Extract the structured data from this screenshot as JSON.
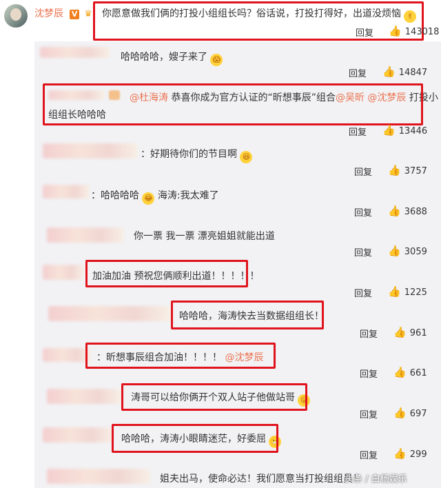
{
  "main_comment": {
    "username": "沈梦辰",
    "verified_badge": "V",
    "text": "你愿意做我们俩的打投小组组长吗？俗话说，打投打得好，出道没烦恼",
    "reply_label": "回复",
    "likes": "143018"
  },
  "replies": [
    {
      "text": "哈哈哈哈，嫂子来了",
      "reply_label": "回复",
      "likes": "14847"
    },
    {
      "text_mention_1": "@杜海涛",
      "text_a": " 恭喜你成为官方认证的“昕想事辰”组合",
      "text_mention_2": "@吴昕",
      "text_mention_3": " @沈梦辰",
      "text_b": " 打投小",
      "text_line2": "组组长哈哈哈",
      "reply_label": "回复",
      "likes": "13446"
    },
    {
      "text": "：好期待你们的节目啊",
      "reply_label": "回复",
      "likes": "3757"
    },
    {
      "text_a": "：哈哈哈哈",
      "text_b": " 海涛:我太难了",
      "reply_label": "回复",
      "likes": "3688"
    },
    {
      "text": "你一票 我一票 漂亮姐姐就能出道",
      "reply_label": "回复",
      "likes": "3059"
    },
    {
      "text": "加油加油 预祝您俩顺利出道！！！！！",
      "reply_label": "回复",
      "likes": "1225"
    },
    {
      "text": "哈哈哈，海涛快去当数据组组长！",
      "reply_label": "回复",
      "likes": "961"
    },
    {
      "text_a": "：昕想事辰组合加油！！！！",
      "text_mention": " @沈梦辰",
      "reply_label": "回复",
      "likes": "661"
    },
    {
      "text": "涛哥可以给你俩开个双人站子他做站哥",
      "reply_label": "回复",
      "likes": "697"
    },
    {
      "text": "哈哈哈，涛涛小眼睛迷茫，好委屈",
      "reply_label": "回复",
      "likes": "299"
    },
    {
      "text": "姐夫出马，使命必达！我们愿意当打投组组员！"
    }
  ],
  "watermark": "头条 / 白杨娱乐",
  "colors": {
    "accent": "#eb7350",
    "highlight_box": "#e0131c",
    "sub_bg": "#f2f2f5"
  },
  "icons": [
    "thumbs-up-icon",
    "verified-badge-icon",
    "crown-icon",
    "emoji-icon"
  ]
}
